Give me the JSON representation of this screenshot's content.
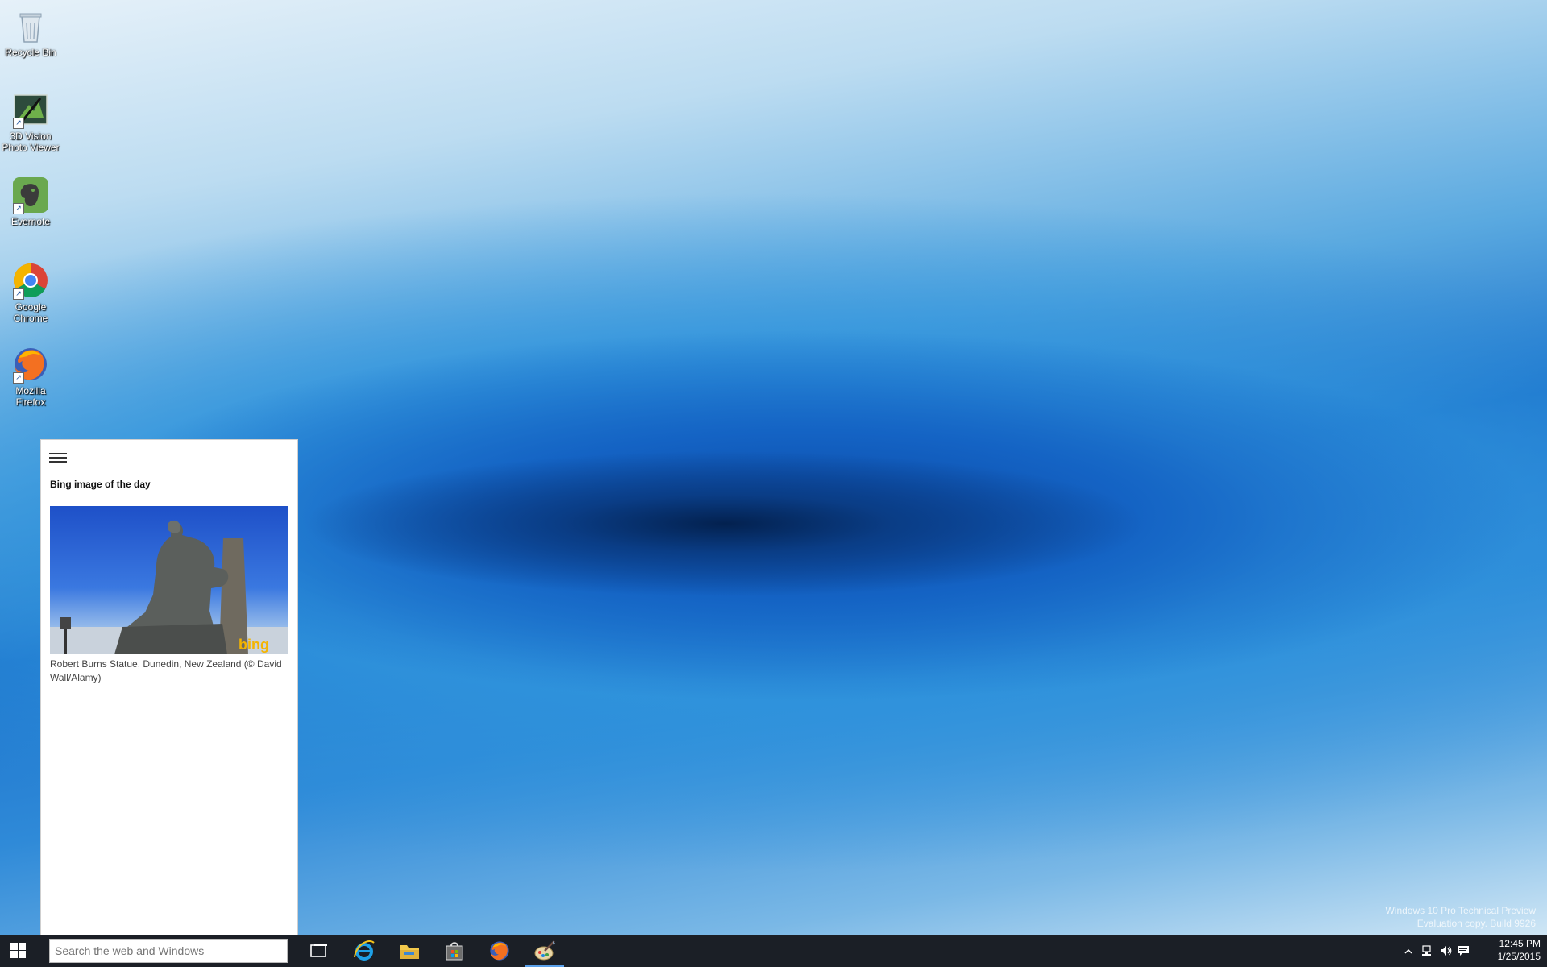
{
  "desktop": {
    "icons": [
      {
        "label": "Recycle Bin",
        "icon": "recycle-bin-icon"
      },
      {
        "label": "3D Vision Photo Viewer",
        "icon": "3d-vision-icon"
      },
      {
        "label": "Evernote",
        "icon": "evernote-icon"
      },
      {
        "label": "Google Chrome",
        "icon": "chrome-icon"
      },
      {
        "label": "Mozilla Firefox",
        "icon": "firefox-icon"
      }
    ],
    "watermark_line1": "Windows 10 Pro Technical Preview",
    "watermark_line2": "Evaluation copy. Build 9926"
  },
  "cortana": {
    "section_title": "Bing image of the day",
    "image_caption": "Robert Burns Statue, Dunedin, New Zealand (© David Wall/Alamy)",
    "image_watermark": "bing"
  },
  "taskbar": {
    "search_placeholder": "Search the web and Windows",
    "pinned": [
      {
        "name": "task-view",
        "icon": "task-view-icon"
      },
      {
        "name": "internet-explorer",
        "icon": "internet-explorer-icon"
      },
      {
        "name": "file-explorer",
        "icon": "file-explorer-icon"
      },
      {
        "name": "store",
        "icon": "store-icon"
      },
      {
        "name": "firefox",
        "icon": "firefox-icon"
      },
      {
        "name": "paint",
        "icon": "paint-icon"
      }
    ],
    "active_app": "paint"
  },
  "tray": {
    "time": "12:45 PM",
    "date": "1/25/2015"
  },
  "colors": {
    "taskbar": "#1b1f26",
    "accent": "#5aa0ea"
  }
}
